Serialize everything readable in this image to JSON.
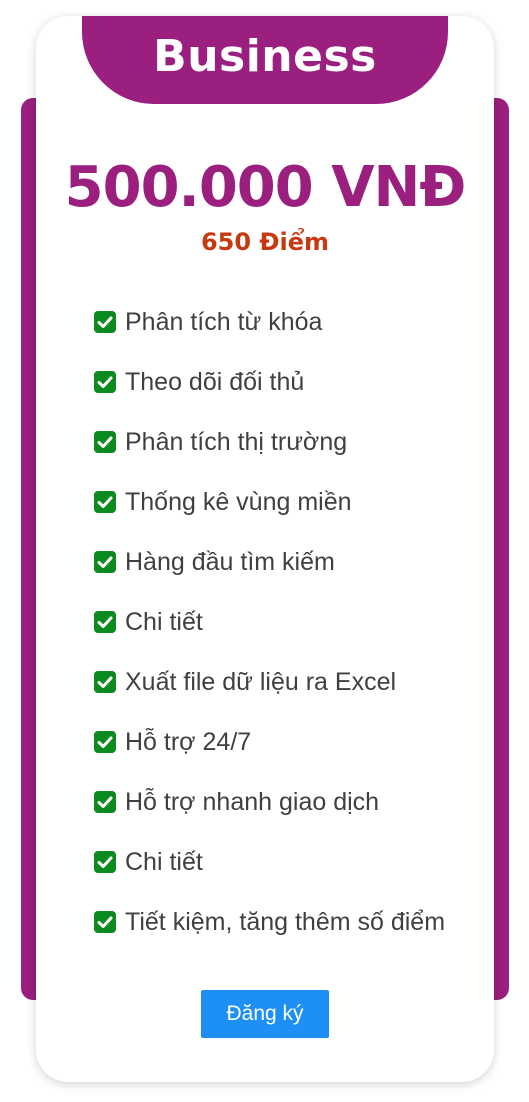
{
  "plan": {
    "name": "Business",
    "price": "500.000 VNĐ",
    "points": "650 Điểm"
  },
  "features": [
    {
      "label": "Phân tích từ khóa"
    },
    {
      "label": "Theo dõi đối thủ"
    },
    {
      "label": "Phân tích thị trường"
    },
    {
      "label": "Thống kê vùng miền"
    },
    {
      "label": "Hàng đầu tìm kiếm"
    },
    {
      "label": "Chi tiết"
    },
    {
      "label": "Xuất file dữ liệu ra Excel"
    },
    {
      "label": "Hỗ trợ 24/7"
    },
    {
      "label": "Hỗ trợ nhanh giao dịch"
    },
    {
      "label": "Chi tiết"
    },
    {
      "label": "Tiết kiệm, tăng thêm số điểm"
    }
  ],
  "feature_icon": "check-square-icon",
  "register_button": {
    "label": "Đăng ký"
  },
  "colors": {
    "brand": "#9b1f7e",
    "points": "#c53a10",
    "check": "#0a8a1f",
    "button": "#1e90f5"
  }
}
